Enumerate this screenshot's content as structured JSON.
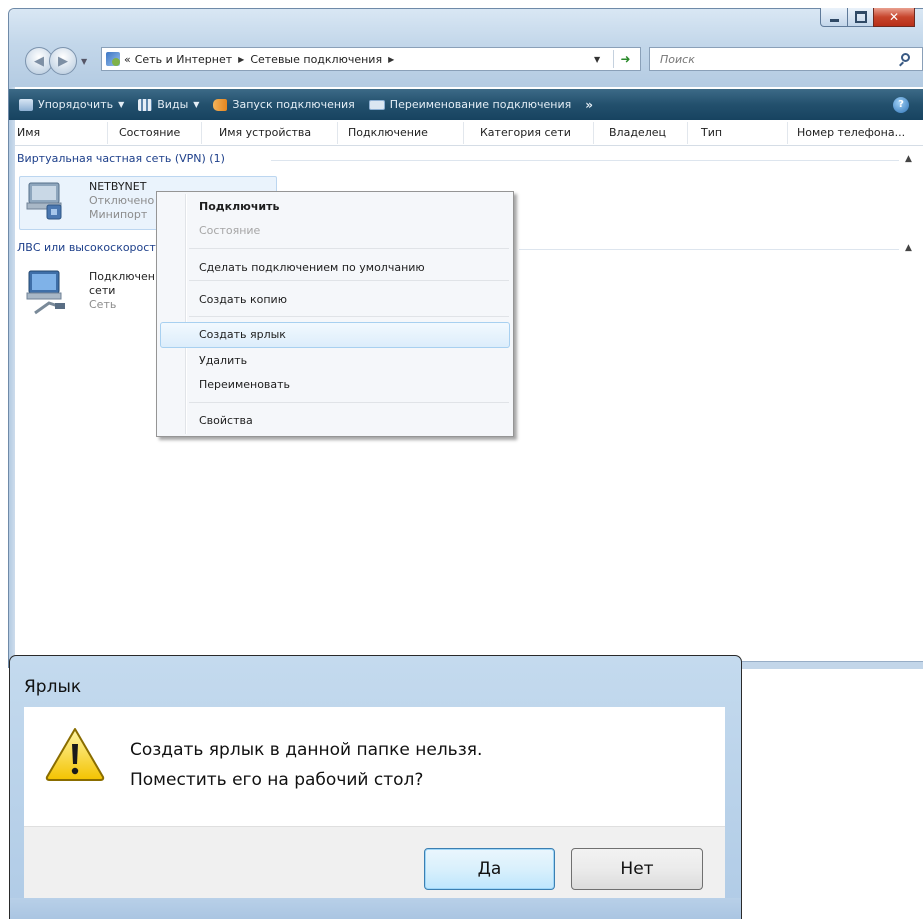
{
  "explorer": {
    "address": {
      "overflow": "«",
      "crumbs": [
        "Сеть и Интернет",
        "Сетевые подключения"
      ]
    },
    "search_placeholder": "Поиск",
    "toolbar": {
      "organize": "Упорядочить",
      "views": "Виды",
      "start_connection": "Запуск подключения",
      "rename_connection": "Переименование подключения",
      "more": "»"
    },
    "columns": [
      "Имя",
      "Состояние",
      "Имя устройства",
      "Подключение",
      "Категория сети",
      "Владелец",
      "Тип",
      "Номер телефона..."
    ],
    "groups": [
      {
        "label": "Виртуальная частная сеть (VPN) (1)",
        "items": [
          {
            "name": "NETBYNET",
            "status": "Отключено",
            "device": "Минипорт"
          }
        ]
      },
      {
        "label": "ЛВС или высокоскоростной Интернет",
        "items": [
          {
            "name_line1": "Подключение по локальной",
            "name_line2": "сети",
            "status": "Сеть"
          }
        ]
      }
    ]
  },
  "context_menu": {
    "items": [
      {
        "label": "Подключить",
        "style": "default"
      },
      {
        "label": "Состояние",
        "style": "disabled"
      },
      {
        "label": "Сделать подключением по умолчанию"
      },
      {
        "label": "Создать копию"
      },
      {
        "label": "Создать ярлык",
        "style": "highlighted"
      },
      {
        "label": "Удалить"
      },
      {
        "label": "Переименовать"
      },
      {
        "label": "Свойства"
      }
    ]
  },
  "dialog": {
    "title": "Ярлык",
    "message_line1": "Создать ярлык в данной папке нельзя.",
    "message_line2": "Поместить его на рабочий стол?",
    "yes_label": "Да",
    "no_label": "Нет"
  },
  "colors": {
    "toolbar": "#23506d",
    "group_header": "#1d3f8a",
    "selection": "#eaf3fc",
    "dialog_frame": "#b0cbe6",
    "close_button": "#c7452c"
  },
  "icons": [
    "back-arrow-icon",
    "forward-arrow-icon",
    "network-folder-icon",
    "refresh-icon",
    "search-icon",
    "help-icon",
    "vpn-connection-icon",
    "lan-connection-icon",
    "warning-icon"
  ]
}
